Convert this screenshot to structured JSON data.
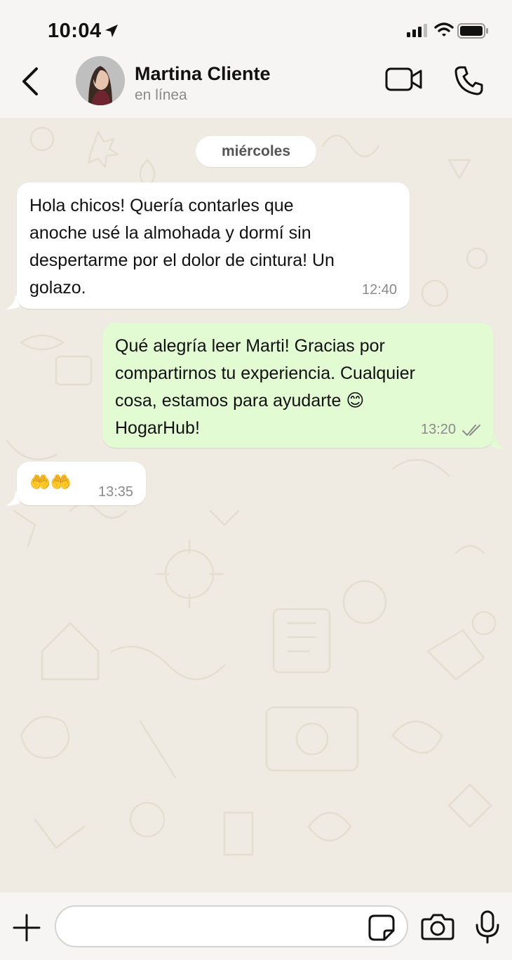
{
  "status_bar": {
    "time": "10:04"
  },
  "header": {
    "contact_name": "Martina Cliente",
    "contact_status": "en línea"
  },
  "chat": {
    "date_label": "miércoles",
    "messages": [
      {
        "direction": "incoming",
        "text": "Hola chicos! Quería contarles que\nanoche usé la almohada y dormí sin\ndespertarme por el dolor de cintura! Un\ngolazo.",
        "time": "12:40"
      },
      {
        "direction": "outgoing",
        "text": "Qué alegría leer Marti! Gracias por\ncompartirnos tu experiencia. Cualquier\ncosa, estamos para ayudarte 😊\nHogarHub!",
        "time": "13:20",
        "status": "read"
      },
      {
        "direction": "incoming",
        "text": "🤲🤲",
        "time": "13:35"
      }
    ]
  },
  "input": {
    "value": "",
    "placeholder": ""
  },
  "colors": {
    "incoming_bubble": "#ffffff",
    "outgoing_bubble": "#e2fbd2",
    "chat_background": "#efeae2",
    "bars": "#f6f5f3"
  },
  "icons": [
    "location-arrow-icon",
    "cellular-signal-icon",
    "wifi-icon",
    "battery-icon",
    "back-chevron-icon",
    "video-camera-icon",
    "phone-icon",
    "double-check-icon",
    "plus-icon",
    "sticker-icon",
    "camera-icon",
    "microphone-icon"
  ]
}
